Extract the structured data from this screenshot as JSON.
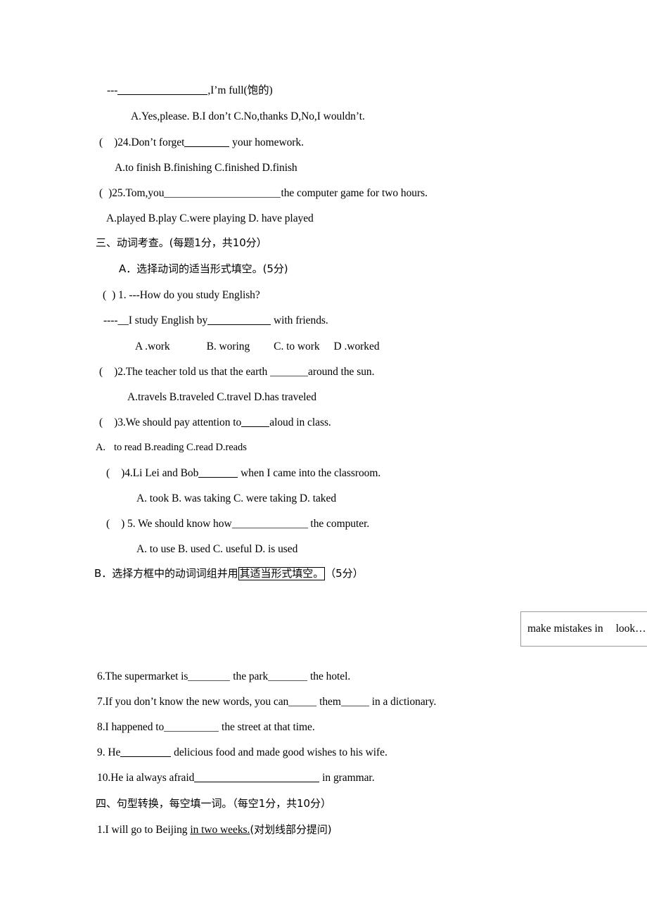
{
  "document": {
    "type": "english-exam-worksheet",
    "language": "zh-CN + en",
    "background_color": "#ffffff",
    "text_color": "#000000"
  },
  "section_two_tail": {
    "q23_stem_prefix": "---",
    "q23_stem_suffix": ",I’m full(饱的)",
    "q23_options": "A.Yes,please.   B.I don’t     C.No,thanks   D,No,I wouldn’t.",
    "q24_marker": "(",
    "q24_close": ")24.Don’t forget",
    "q24_tail": " your homework.",
    "q24_options": "A.to finish   B.finishing   C.finished D.finish",
    "q25_marker": "(",
    "q25_close": ")25.Tom,you",
    "q25_tail": "the computer game for two hours.",
    "q25_options": "A.played   B.play   C.were playing   D. have played"
  },
  "section_three": {
    "heading": "三、动词考查。(每题1分，共10分）",
    "part_a_heading": "A．选择动词的适当形式填空。(5分)",
    "q1_marker": "(",
    "q1_close": ") 1. ---How do you study English?",
    "q1_answer_lead": "----__I study English by",
    "q1_answer_tail": " with friends.",
    "q1_options": {
      "a": "A .work",
      "b": "B. woring",
      "c": "C. to work",
      "d": "D .worked"
    },
    "q2_marker": "(",
    "q2_close": ")2.The teacher told us that the earth ",
    "q2_tail": "around the sun.",
    "q2_options": "A.travels   B.traveled  C.travel   D.has traveled",
    "q3_marker": "(",
    "q3_close": ")3.We should pay attention to",
    "q3_tail": "aloud in class.",
    "q3_options_letter": "A.",
    "q3_options": "to read  B.reading  C.read  D.reads",
    "q4_marker": "(",
    "q4_close": ")4.Li Lei and Bob",
    "q4_tail": " when I came into the classroom.",
    "q4_options": "A. took   B. was taking   C. were taking   D. taked",
    "q5_marker": "(",
    "q5_close": ") 5. We should know how",
    "q5_tail": " the computer.",
    "q5_options": "A. to use    B. used   C. useful   D. is used",
    "part_b_heading_pre": "B．选择方框中的动词词组并用",
    "part_b_heading_boxed": "其适当形式填空。",
    "part_b_heading_post": "（5分）",
    "word_bank": {
      "item_1": "make mistakes in",
      "item_2": "look…",
      "border_color": "#9a9a9a"
    },
    "q6": {
      "lead": "6.The supermarket is",
      "mid": " the park",
      "tail": " the hotel."
    },
    "q7": {
      "lead": "7.If you don’t know the new words, you can",
      "mid": " them",
      "tail": " in a dictionary."
    },
    "q8": {
      "lead": "8.I happened to",
      "tail": " the street at that time."
    },
    "q9": {
      "lead": "9. He",
      "tail": " delicious food and made good wishes to his wife."
    },
    "q10": {
      "lead": "10.He ia always afraid",
      "tail": " in grammar."
    }
  },
  "section_four": {
    "heading": "四、句型转换，每空填一词。（每空1分，共10分）",
    "q1_lead": "1.I will go to Beijing ",
    "q1_underlined": "in two weeks.",
    "q1_tail": "(对划线部分提问)"
  }
}
